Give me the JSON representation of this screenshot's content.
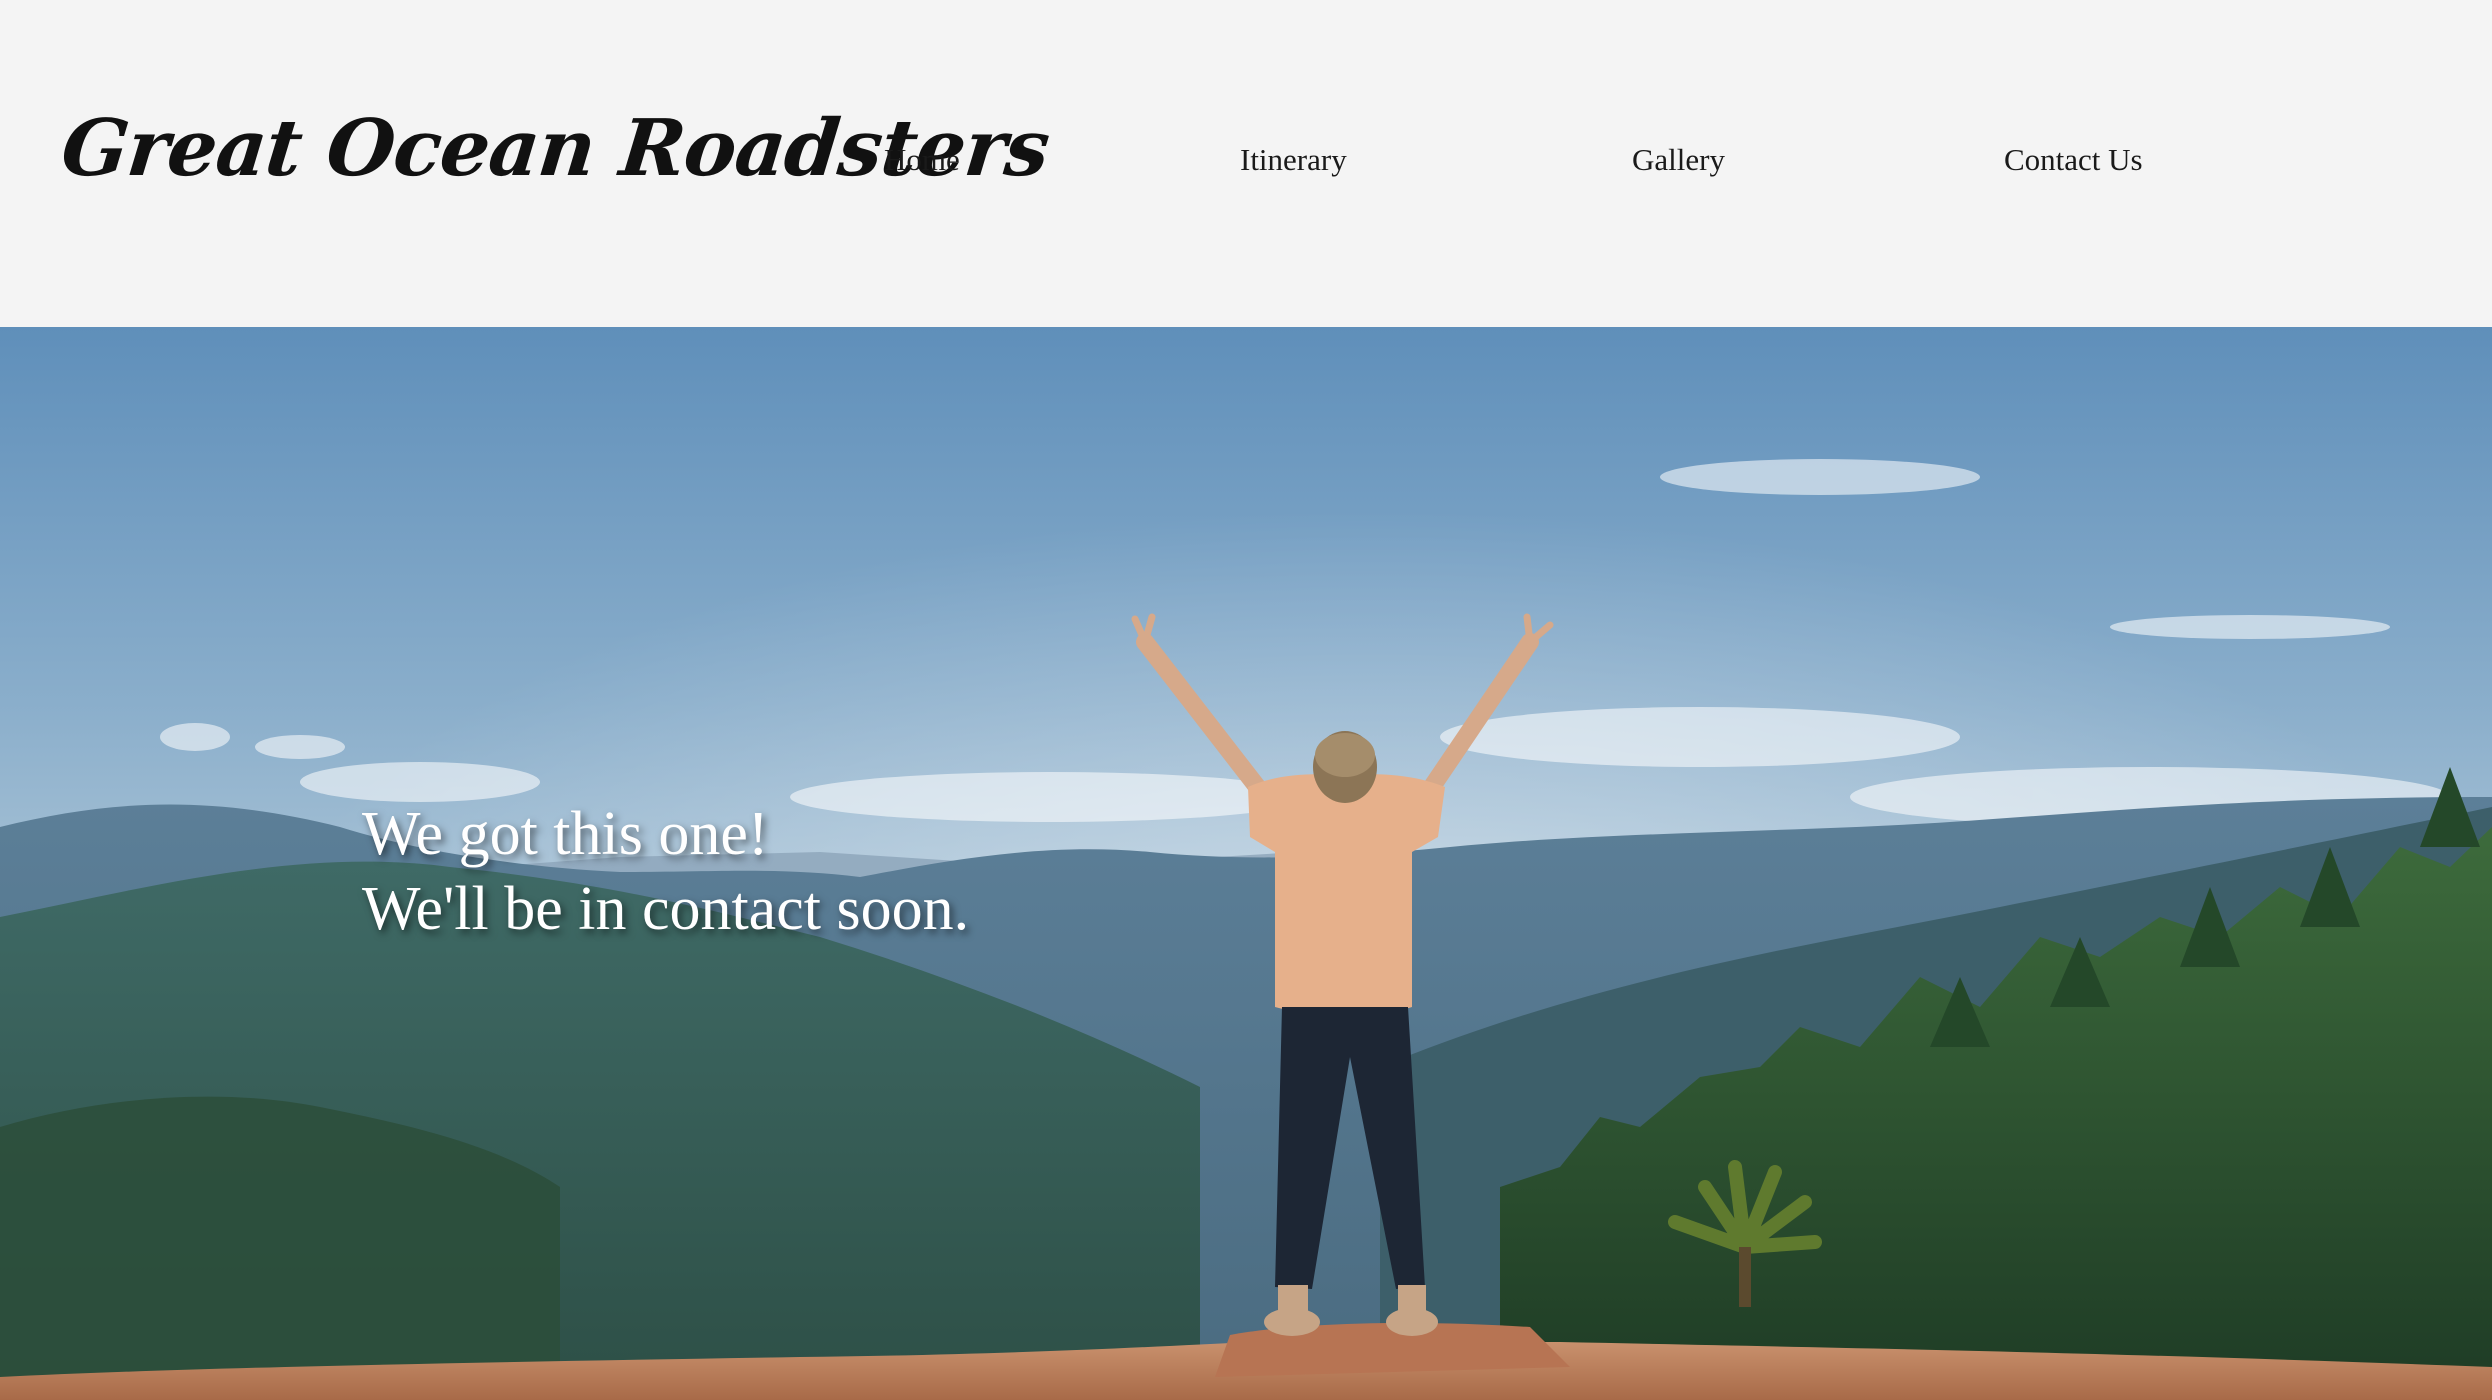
{
  "brand": {
    "name": "Great Ocean Roadsters"
  },
  "nav": {
    "items": [
      {
        "label": "Home"
      },
      {
        "label": "Itinerary"
      },
      {
        "label": "Gallery"
      },
      {
        "label": "Contact Us"
      }
    ]
  },
  "hero": {
    "line1": "We got this one!",
    "line2": "We'll be in contact soon."
  },
  "colors": {
    "header_bg": "#f4f4f4",
    "text_dark": "#111111",
    "hero_text": "#ffffff"
  }
}
